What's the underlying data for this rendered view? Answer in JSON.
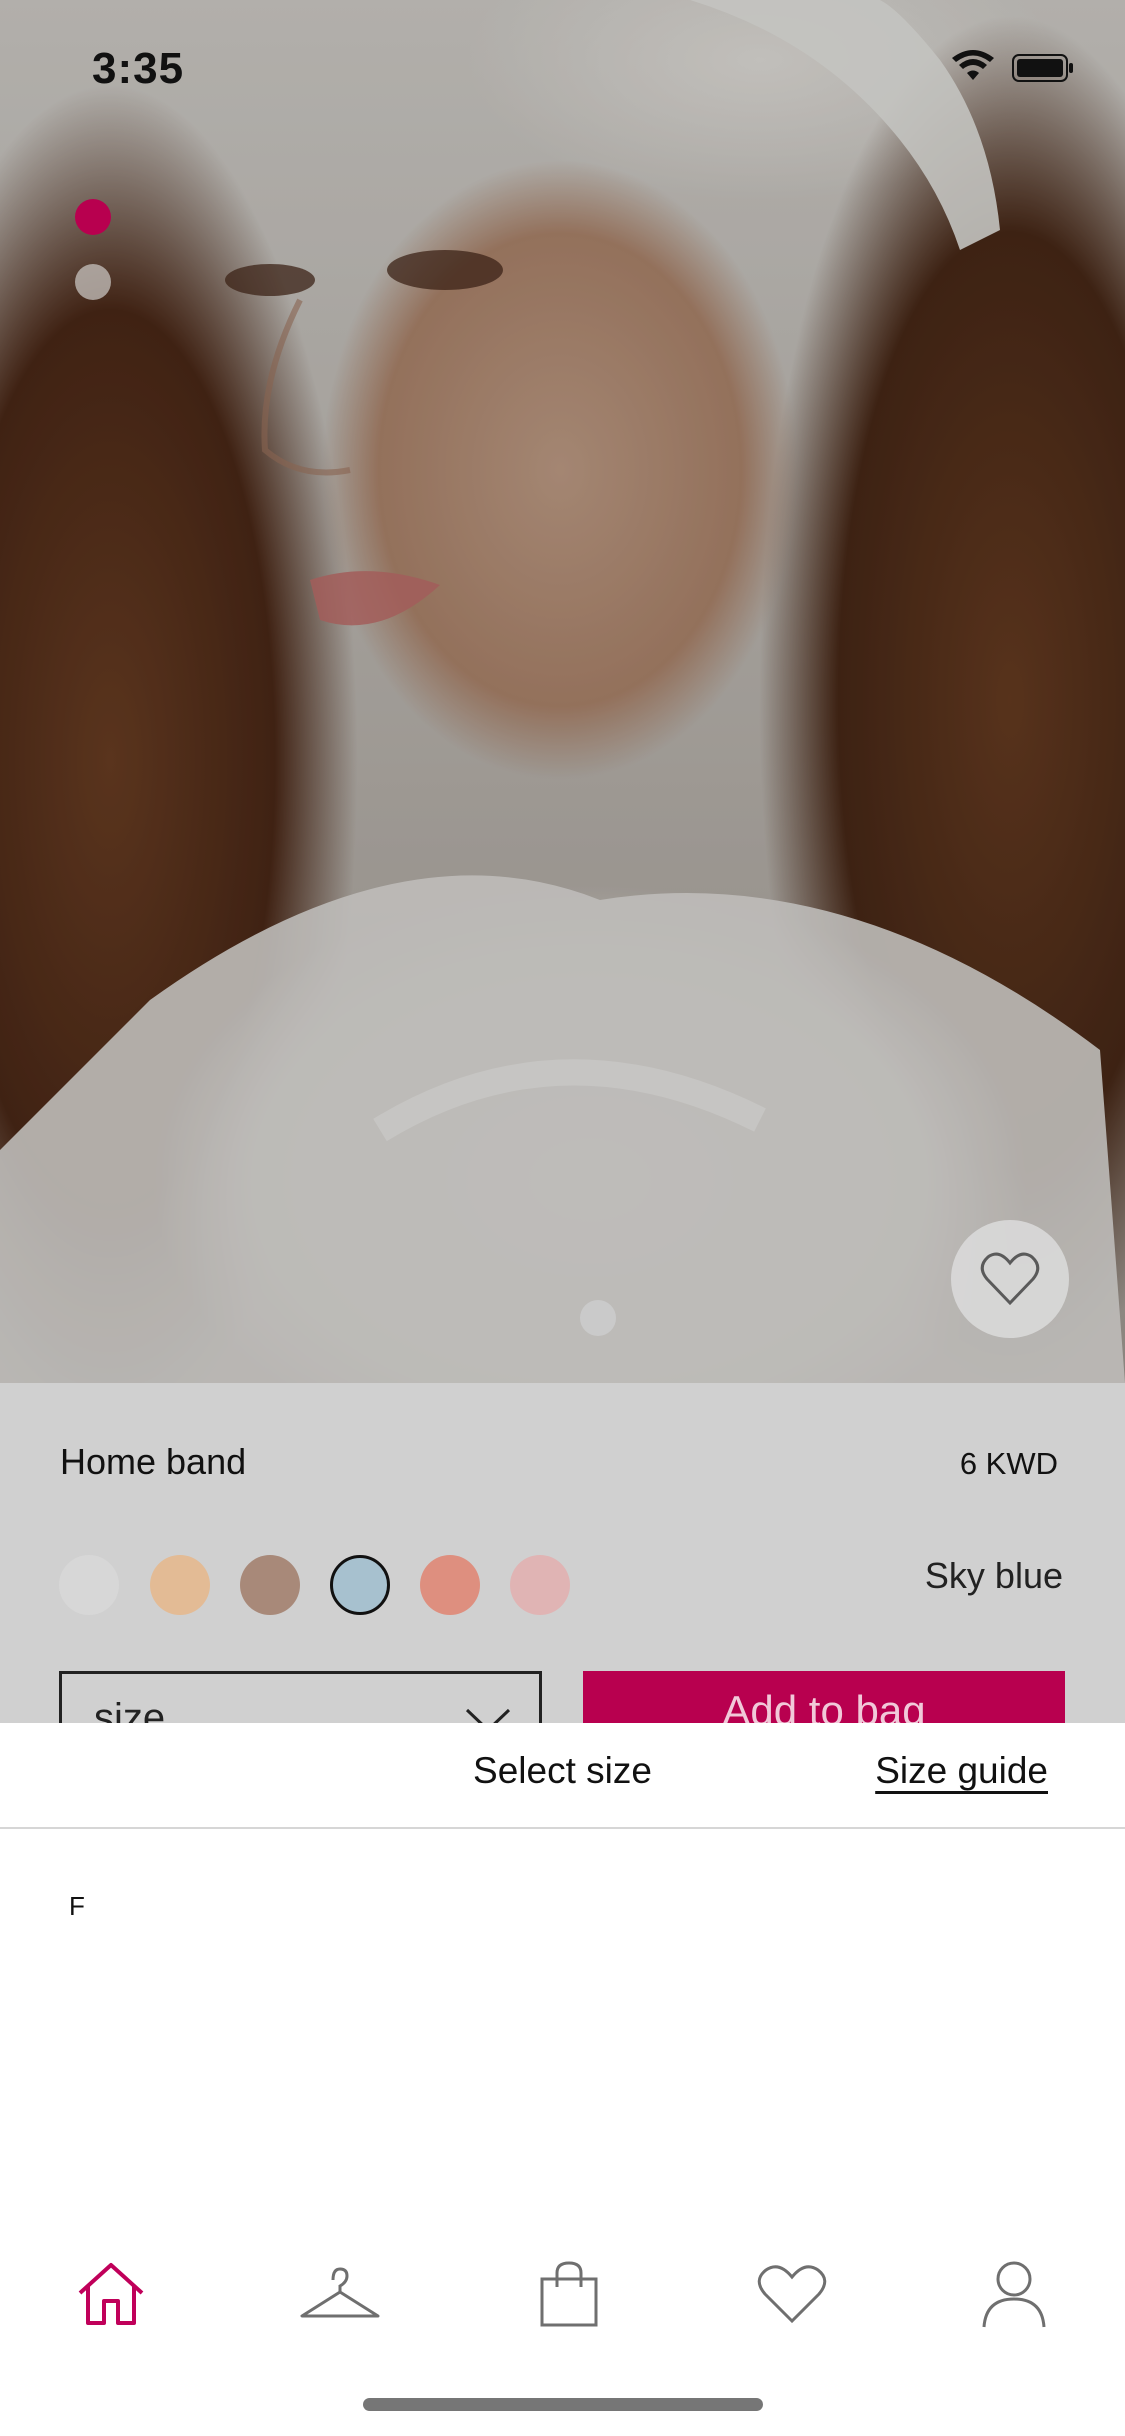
{
  "status_bar": {
    "time": "3:35"
  },
  "gallery": {
    "page_count": 2,
    "active_index": 0,
    "active_color": "#b8004f"
  },
  "product": {
    "name": "Home band",
    "price": "6 KWD",
    "selected_color_name": "Sky blue",
    "swatches": [
      {
        "color": "#d7d7d7",
        "selected": false
      },
      {
        "color": "#e3bb95",
        "selected": false
      },
      {
        "color": "#a88979",
        "selected": false
      },
      {
        "color": "#a7c1cf",
        "selected": true
      },
      {
        "color": "#de8f7f",
        "selected": false
      },
      {
        "color": "#e0b4b4",
        "selected": false
      }
    ],
    "size_select_label": "size",
    "add_to_bag_label": "Add to bag",
    "add_to_bag_color": "#b8004f"
  },
  "size_sheet": {
    "title": "Select size",
    "size_guide_label": "Size guide",
    "options": [
      "F"
    ]
  },
  "tab_bar": {
    "active_color": "#c0005a",
    "inactive_color": "#6f6f6f",
    "items": [
      {
        "icon": "home-icon",
        "active": true
      },
      {
        "icon": "hanger-icon",
        "active": false
      },
      {
        "icon": "shopping-bag-icon",
        "active": false
      },
      {
        "icon": "heart-icon",
        "active": false
      },
      {
        "icon": "profile-icon",
        "active": false
      }
    ]
  }
}
